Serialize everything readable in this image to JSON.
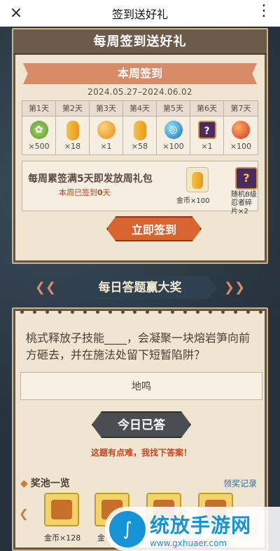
{
  "topbar": {
    "close_icon": "×",
    "title": "签到送好礼",
    "more_icon": "⋮"
  },
  "weekly_card": {
    "banner": "每周签到送好礼",
    "sub_banner": "本周签到",
    "date_range": "2024.05.27–2024.06.02",
    "days": [
      {
        "label": "第1天",
        "icon": "cabbage-icon",
        "qty": "×500"
      },
      {
        "label": "第2天",
        "icon": "coin-icon",
        "qty": "×18"
      },
      {
        "label": "第3天",
        "icon": "pearl-icon",
        "qty": "×1"
      },
      {
        "label": "第4天",
        "icon": "coin-icon",
        "qty": "×58"
      },
      {
        "label": "第5天",
        "icon": "orb-icon",
        "qty": "×100"
      },
      {
        "label": "第6天",
        "icon": "puzzle-icon",
        "qty": "×1"
      },
      {
        "label": "第7天",
        "icon": "ember-icon",
        "qty": "×100"
      }
    ],
    "weekly_text": "每周累签满5天即发放周礼包",
    "weekly_progress_prefix": "本周已签到",
    "weekly_progress_value": "0",
    "weekly_progress_suffix": "天",
    "reward1_caption": "金币×100",
    "reward2_caption_line1": "随机B级",
    "reward2_caption_line2": "忍者碎片×2",
    "sign_button": "立即签到"
  },
  "quiz_section": {
    "title": "每日答题赢大奖",
    "question": "桃式释放子技能____，会凝聚一块熔岩笋向前方砸去，并在施法处留下短暂陷阱？",
    "answer": "地鸣",
    "answered_button": "今日已答",
    "hint": "这题有点难，我找下答案！",
    "pool_title": "奖池一览",
    "record_link": "领奖记录",
    "pool_items": [
      {
        "caption": "金币×128"
      },
      {
        "caption": "金"
      }
    ]
  },
  "watermark": {
    "brand": "统放手游网",
    "url": "www.gxhuaer.com"
  }
}
